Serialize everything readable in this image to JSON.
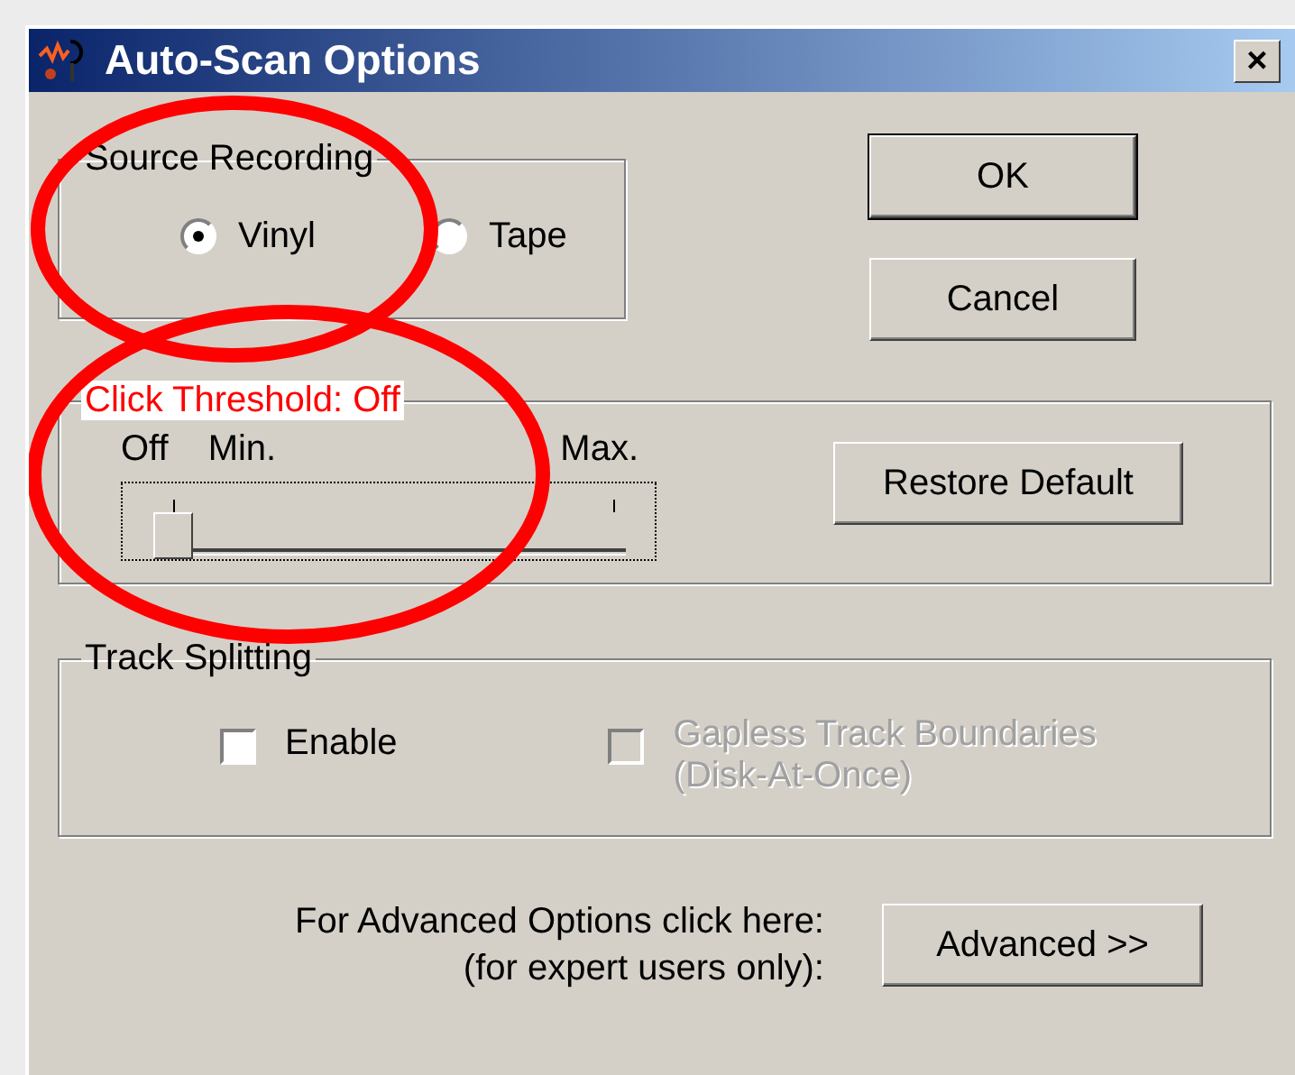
{
  "window": {
    "title": "Auto-Scan Options",
    "close": "×"
  },
  "source_recording": {
    "label": "Source Recording",
    "options": [
      {
        "label": "Vinyl",
        "selected": true
      },
      {
        "label": "Tape",
        "selected": false
      }
    ]
  },
  "buttons": [
    "OK",
    "Cancel"
  ],
  "click_threshold": {
    "label": "Click Threshold: Off",
    "off_label": "Off",
    "min_label": "Min.",
    "max_label": "Max.",
    "level": 0,
    "restore_button": "Restore Default"
  },
  "track_splitting": {
    "label": "Track Splitting",
    "options": [
      {
        "lines": [
          "Enable"
        ],
        "checked": false,
        "disabled": false
      },
      {
        "lines": [
          "Gapless Track Boundaries",
          "(Disk-At-Once)"
        ],
        "checked": false,
        "disabled": true
      }
    ]
  },
  "advanced": {
    "hint_lines": [
      "For Advanced Options click here:",
      "(for expert users only):"
    ],
    "button": "Advanced >>"
  }
}
